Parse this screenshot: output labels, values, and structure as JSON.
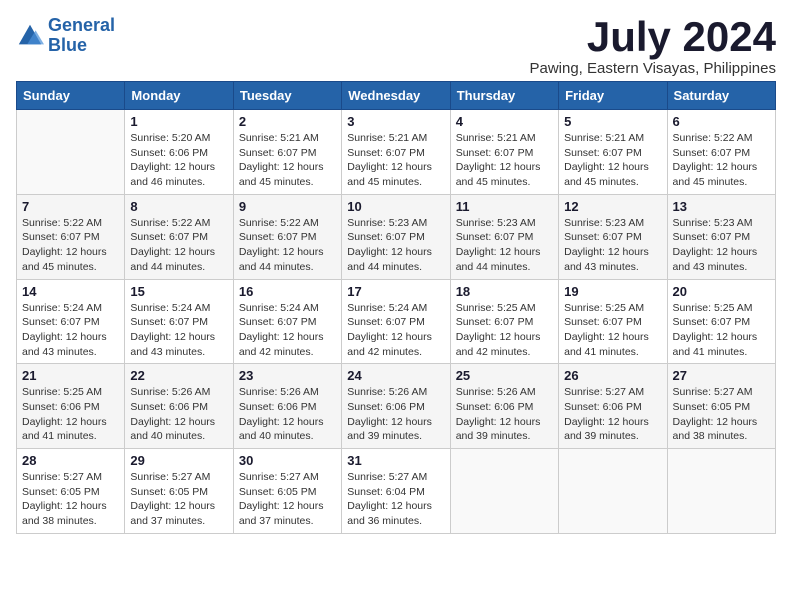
{
  "logo": {
    "line1": "General",
    "line2": "Blue"
  },
  "title": "July 2024",
  "subtitle": "Pawing, Eastern Visayas, Philippines",
  "weekdays": [
    "Sunday",
    "Monday",
    "Tuesday",
    "Wednesday",
    "Thursday",
    "Friday",
    "Saturday"
  ],
  "weeks": [
    [
      {
        "day": "",
        "info": ""
      },
      {
        "day": "1",
        "info": "Sunrise: 5:20 AM\nSunset: 6:06 PM\nDaylight: 12 hours\nand 46 minutes."
      },
      {
        "day": "2",
        "info": "Sunrise: 5:21 AM\nSunset: 6:07 PM\nDaylight: 12 hours\nand 45 minutes."
      },
      {
        "day": "3",
        "info": "Sunrise: 5:21 AM\nSunset: 6:07 PM\nDaylight: 12 hours\nand 45 minutes."
      },
      {
        "day": "4",
        "info": "Sunrise: 5:21 AM\nSunset: 6:07 PM\nDaylight: 12 hours\nand 45 minutes."
      },
      {
        "day": "5",
        "info": "Sunrise: 5:21 AM\nSunset: 6:07 PM\nDaylight: 12 hours\nand 45 minutes."
      },
      {
        "day": "6",
        "info": "Sunrise: 5:22 AM\nSunset: 6:07 PM\nDaylight: 12 hours\nand 45 minutes."
      }
    ],
    [
      {
        "day": "7",
        "info": "Sunrise: 5:22 AM\nSunset: 6:07 PM\nDaylight: 12 hours\nand 45 minutes."
      },
      {
        "day": "8",
        "info": "Sunrise: 5:22 AM\nSunset: 6:07 PM\nDaylight: 12 hours\nand 44 minutes."
      },
      {
        "day": "9",
        "info": "Sunrise: 5:22 AM\nSunset: 6:07 PM\nDaylight: 12 hours\nand 44 minutes."
      },
      {
        "day": "10",
        "info": "Sunrise: 5:23 AM\nSunset: 6:07 PM\nDaylight: 12 hours\nand 44 minutes."
      },
      {
        "day": "11",
        "info": "Sunrise: 5:23 AM\nSunset: 6:07 PM\nDaylight: 12 hours\nand 44 minutes."
      },
      {
        "day": "12",
        "info": "Sunrise: 5:23 AM\nSunset: 6:07 PM\nDaylight: 12 hours\nand 43 minutes."
      },
      {
        "day": "13",
        "info": "Sunrise: 5:23 AM\nSunset: 6:07 PM\nDaylight: 12 hours\nand 43 minutes."
      }
    ],
    [
      {
        "day": "14",
        "info": "Sunrise: 5:24 AM\nSunset: 6:07 PM\nDaylight: 12 hours\nand 43 minutes."
      },
      {
        "day": "15",
        "info": "Sunrise: 5:24 AM\nSunset: 6:07 PM\nDaylight: 12 hours\nand 43 minutes."
      },
      {
        "day": "16",
        "info": "Sunrise: 5:24 AM\nSunset: 6:07 PM\nDaylight: 12 hours\nand 42 minutes."
      },
      {
        "day": "17",
        "info": "Sunrise: 5:24 AM\nSunset: 6:07 PM\nDaylight: 12 hours\nand 42 minutes."
      },
      {
        "day": "18",
        "info": "Sunrise: 5:25 AM\nSunset: 6:07 PM\nDaylight: 12 hours\nand 42 minutes."
      },
      {
        "day": "19",
        "info": "Sunrise: 5:25 AM\nSunset: 6:07 PM\nDaylight: 12 hours\nand 41 minutes."
      },
      {
        "day": "20",
        "info": "Sunrise: 5:25 AM\nSunset: 6:07 PM\nDaylight: 12 hours\nand 41 minutes."
      }
    ],
    [
      {
        "day": "21",
        "info": "Sunrise: 5:25 AM\nSunset: 6:06 PM\nDaylight: 12 hours\nand 41 minutes."
      },
      {
        "day": "22",
        "info": "Sunrise: 5:26 AM\nSunset: 6:06 PM\nDaylight: 12 hours\nand 40 minutes."
      },
      {
        "day": "23",
        "info": "Sunrise: 5:26 AM\nSunset: 6:06 PM\nDaylight: 12 hours\nand 40 minutes."
      },
      {
        "day": "24",
        "info": "Sunrise: 5:26 AM\nSunset: 6:06 PM\nDaylight: 12 hours\nand 39 minutes."
      },
      {
        "day": "25",
        "info": "Sunrise: 5:26 AM\nSunset: 6:06 PM\nDaylight: 12 hours\nand 39 minutes."
      },
      {
        "day": "26",
        "info": "Sunrise: 5:27 AM\nSunset: 6:06 PM\nDaylight: 12 hours\nand 39 minutes."
      },
      {
        "day": "27",
        "info": "Sunrise: 5:27 AM\nSunset: 6:05 PM\nDaylight: 12 hours\nand 38 minutes."
      }
    ],
    [
      {
        "day": "28",
        "info": "Sunrise: 5:27 AM\nSunset: 6:05 PM\nDaylight: 12 hours\nand 38 minutes."
      },
      {
        "day": "29",
        "info": "Sunrise: 5:27 AM\nSunset: 6:05 PM\nDaylight: 12 hours\nand 37 minutes."
      },
      {
        "day": "30",
        "info": "Sunrise: 5:27 AM\nSunset: 6:05 PM\nDaylight: 12 hours\nand 37 minutes."
      },
      {
        "day": "31",
        "info": "Sunrise: 5:27 AM\nSunset: 6:04 PM\nDaylight: 12 hours\nand 36 minutes."
      },
      {
        "day": "",
        "info": ""
      },
      {
        "day": "",
        "info": ""
      },
      {
        "day": "",
        "info": ""
      }
    ]
  ]
}
